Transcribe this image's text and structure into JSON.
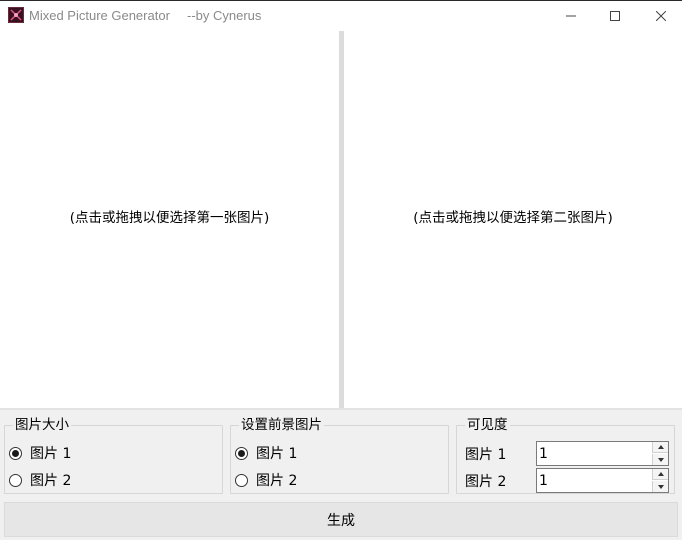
{
  "window": {
    "title": "Mixed Picture Generator",
    "author": "--by Cynerus",
    "icon": "app-icon"
  },
  "panels": {
    "left_hint": "(点击或拖拽以便选择第一张图片)",
    "right_hint": "(点击或拖拽以便选择第二张图片)"
  },
  "size_group": {
    "title": "图片大小",
    "options": [
      "图片 1",
      "图片 2"
    ],
    "selected": "图片 1"
  },
  "foreground_group": {
    "title": "设置前景图片",
    "options": [
      "图片 1",
      "图片 2"
    ],
    "selected": "图片 1"
  },
  "visibility_group": {
    "title": "可见度",
    "rows": [
      {
        "label": "图片 1",
        "value": "1"
      },
      {
        "label": "图片 2",
        "value": "1"
      }
    ]
  },
  "generate_label": "生成",
  "colors": {
    "window_bg": "#f0f0f0",
    "panel_bg": "#ffffff",
    "title_text": "#8a8a8a"
  }
}
